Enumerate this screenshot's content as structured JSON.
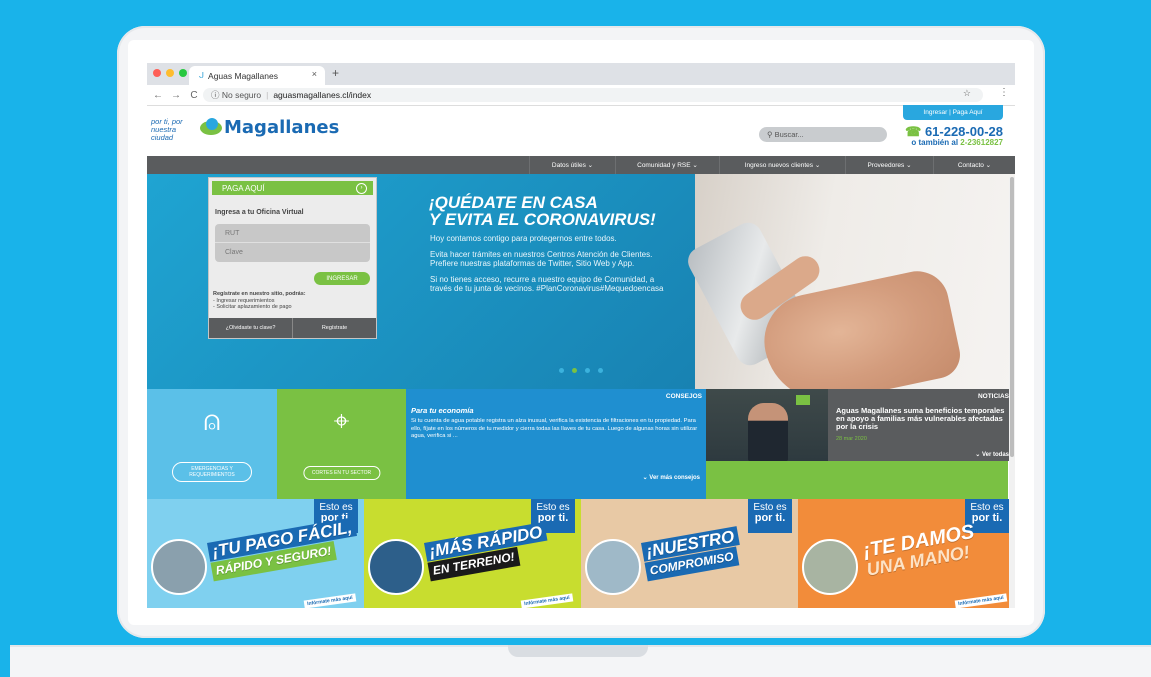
{
  "browser": {
    "tab_title": "Aguas Magallanes",
    "new_tab": "+",
    "close": "×",
    "security": "No seguro",
    "url": "aguasmagallanes.cl/index"
  },
  "header": {
    "tagline": "por ti, por nuestra ciudad",
    "logo_text": "Magallanes",
    "search_placeholder": "Buscar...",
    "login_label": "Ingresar | Paga Aquí",
    "phone_main": "61-228-00-28",
    "phone_alt_prefix": "o también al",
    "phone_alt": "2-23612827"
  },
  "nav": [
    {
      "label": "Datos útiles ⌄"
    },
    {
      "label": "Comunidad y RSE ⌄"
    },
    {
      "label": "Ingreso nuevos clientes ⌄"
    },
    {
      "label": "Proveedores ⌄"
    },
    {
      "label": "Contacto ⌄"
    }
  ],
  "pay_box": {
    "title": "PAGA AQUÍ",
    "subtitle": "Ingresa a tu Oficina Virtual",
    "rut_placeholder": "RUT",
    "clave_placeholder": "Clave",
    "submit": "INGRESAR",
    "note_title": "Regístrate en nuestro sitio, podrás:",
    "note_1": "- Ingresar requerimientos",
    "note_2": "- Solicitar aplazamiento de pago",
    "forgot": "¿Olvidaste tu clave?",
    "register": "Regístrate"
  },
  "hero": {
    "title_1": "¡QUÉDATE EN CASA",
    "title_2": "Y EVITA EL CORONAVIRUS!",
    "p1": "Hoy contamos contigo para protegernos entre todos.",
    "p2": "Evita hacer trámites en nuestros Centros Atención de Clientes. Prefiere nuestras plataformas de Twitter, Sitio Web y App.",
    "p3": "Si no tienes acceso, recurre a nuestro equipo de Comunidad, a través de tu junta de vecinos. #PlanCoronavirus#Mequedoencasa",
    "active_slide": 2
  },
  "tiles": {
    "emergencias": "EMERGENCIAS Y REQUERIMIENTOS",
    "cortes": "CORTES EN TU SECTOR",
    "consejos_tag": "CONSEJOS",
    "consejos_title": "Para tu economía",
    "consejos_body": "Si tu cuenta de agua potable registra un alza inusual, verifica la existencia de filtraciones en tu propiedad. Para ello, fíjate en los números de tu medidor y cierra todas las llaves de tu casa. Luego de algunas horas sin utilizar agua, verifica si ...",
    "consejos_more": "⌄ Ver más consejos",
    "noticias_tag": "NOTICIAS",
    "noticias_headline": "Aguas Magallanes suma beneficios temporales en apoyo a familias más vulnerables afectadas por la crisis",
    "noticias_date": "28 mar 2020",
    "noticias_more": "⌄ Ver todas"
  },
  "banners": [
    {
      "esto": "Esto es",
      "porti": "por ti.",
      "line1": "¡TU PAGO FÁCIL,",
      "line2": "RÁPIDO Y SEGURO!",
      "cta": "Infórmate más aquí"
    },
    {
      "esto": "Esto es",
      "porti": "por ti.",
      "line1": "¡MÁS RÁPIDO",
      "line2": "EN TERRENO!",
      "cta": "Infórmate más aquí"
    },
    {
      "esto": "Esto es",
      "porti": "por ti.",
      "line1": "¡NUESTRO",
      "line2": "COMPROMISO",
      "cta": ""
    },
    {
      "esto": "Esto es",
      "porti": "por ti.",
      "line1": "¡TE DAMOS",
      "line2": "UNA MANO!",
      "cta": "Infórmate más aquí"
    }
  ],
  "colors": {
    "background": "#19b3ea",
    "brand_blue": "#1a6ab3",
    "brand_green": "#7ac143",
    "nav_gray": "#5a5c5e"
  }
}
